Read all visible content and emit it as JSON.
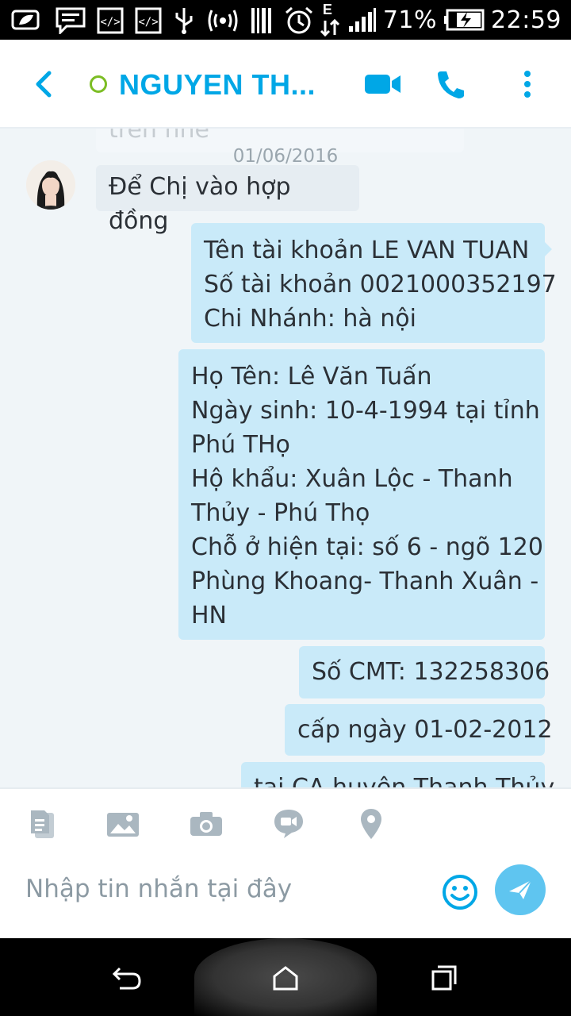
{
  "status_bar": {
    "battery_percent": "71%",
    "time": "22:59",
    "network_type": "E",
    "icons_left": [
      "leaf-message-icon",
      "message-icon",
      "code-icon",
      "code-icon",
      "usb-icon",
      "hotspot-icon",
      "barcode-icon",
      "alarm-icon"
    ]
  },
  "header": {
    "contact_name": "NGUYEN TH...",
    "presence": "online",
    "accent_color": "#00a7e6"
  },
  "chat": {
    "faded_partial_text": "trên nhé",
    "date_separator": "01/06/2016",
    "incoming_message": "Để Chị vào hợp đồng",
    "outgoing_messages": [
      {
        "lines": [
          "Tên tài khoản LE VAN TUAN",
          "Số tài khoản 0021000352197",
          "Chi Nhánh: hà nội"
        ]
      },
      {
        "lines": [
          "Họ Tên: Lê Văn Tuấn",
          "Ngày sinh: 10-4-1994 tại tỉnh",
          "Phú THọ",
          "Hộ khẩu: Xuân Lộc - Thanh",
          "Thủy - Phú Thọ",
          "Chỗ ở hiện tại: số 6 - ngõ 120",
          "Phùng Khoang- Thanh Xuân -",
          "HN"
        ]
      },
      {
        "lines": [
          "Số CMT: 132258306"
        ]
      },
      {
        "lines": [
          "cấp ngày 01-02-2012"
        ]
      },
      {
        "lines": [
          "tại CA huyện Thanh Thủy"
        ]
      }
    ]
  },
  "composer": {
    "placeholder": "Nhập tin nhắn tại đây",
    "tools": [
      "file-icon",
      "gallery-icon",
      "camera-icon",
      "video-message-icon",
      "location-icon"
    ]
  }
}
